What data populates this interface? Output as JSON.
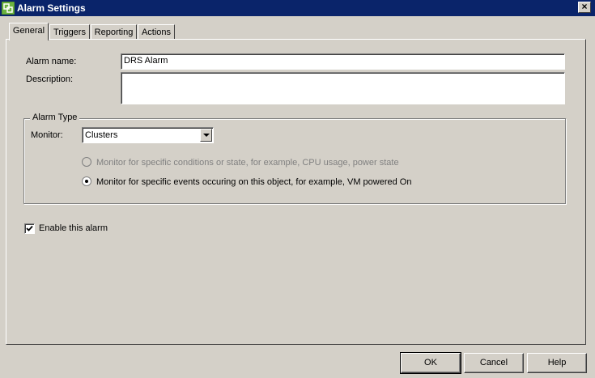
{
  "window": {
    "title": "Alarm Settings",
    "icon": "vsphere-app-icon",
    "close_label": "×"
  },
  "tabs": [
    {
      "label": "General",
      "active": true
    },
    {
      "label": "Triggers",
      "active": false
    },
    {
      "label": "Reporting",
      "active": false
    },
    {
      "label": "Actions",
      "active": false
    }
  ],
  "general": {
    "alarm_name_label": "Alarm name:",
    "alarm_name_value": "DRS Alarm",
    "description_label": "Description:",
    "description_value": "",
    "alarm_type": {
      "group_title": "Alarm Type",
      "monitor_label": "Monitor:",
      "monitor_value": "Clusters",
      "options": [
        {
          "label": "Monitor for specific conditions or state, for example, CPU usage, power state",
          "selected": false,
          "enabled": false
        },
        {
          "label": "Monitor for specific events occuring on this object, for example, VM powered On",
          "selected": true,
          "enabled": true
        }
      ]
    },
    "enable_label": "Enable this alarm",
    "enable_checked": true
  },
  "footer": {
    "ok_label": "OK",
    "cancel_label": "Cancel",
    "help_label": "Help"
  },
  "colors": {
    "title_bar": "#0a246a",
    "dialog_bg": "#d4d0c8",
    "icon_green": "#6cb33f"
  }
}
